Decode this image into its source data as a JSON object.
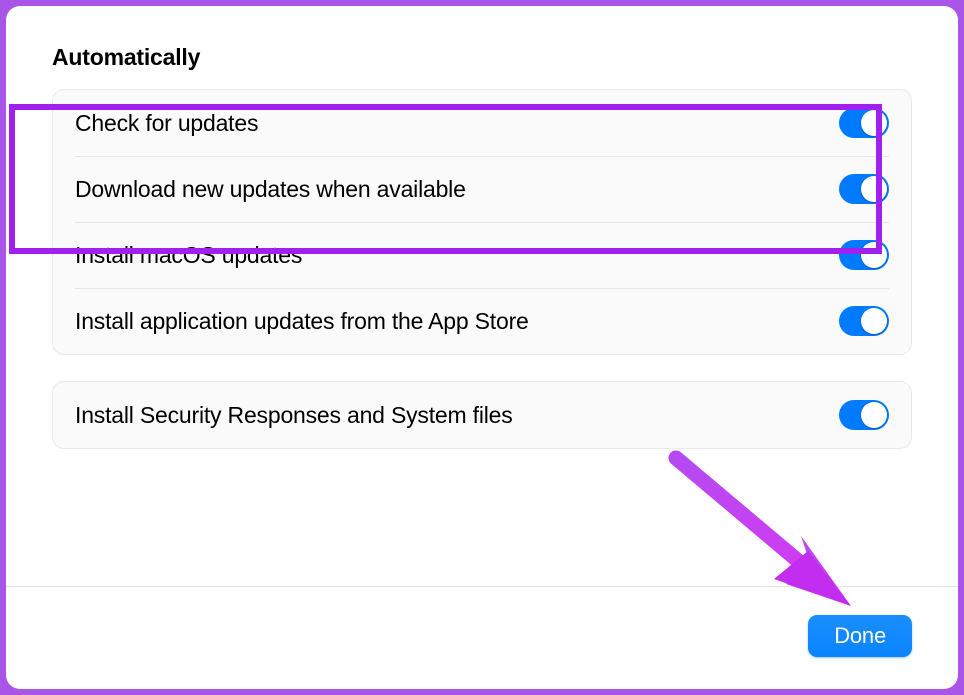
{
  "title": "Automatically",
  "groups": [
    {
      "rows": [
        {
          "label": "Check for updates",
          "on": true
        },
        {
          "label": "Download new updates when available",
          "on": true
        },
        {
          "label": "Install macOS updates",
          "on": true
        },
        {
          "label": "Install application updates from the App Store",
          "on": true
        }
      ]
    },
    {
      "rows": [
        {
          "label": "Install Security Responses and System files",
          "on": true
        }
      ]
    }
  ],
  "doneLabel": "Done",
  "annotations": {
    "highlight_color": "#a020f0",
    "arrow_color": "#c22df0"
  }
}
